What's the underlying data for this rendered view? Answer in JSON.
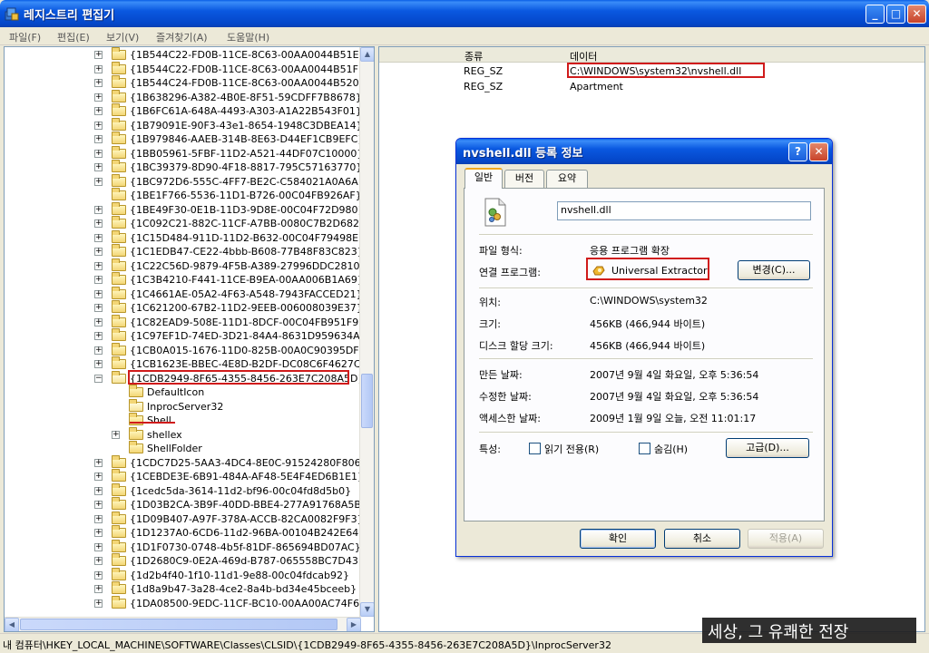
{
  "window": {
    "title": "레지스트리 편집기",
    "min_glyph": "_",
    "max_glyph": "□",
    "close_glyph": "✕"
  },
  "menu": [
    "파일(F)",
    "편집(E)",
    "보기(V)",
    "즐겨찾기(A)",
    "도움말(H)"
  ],
  "tree": {
    "items": [
      {
        "label": "{1B544C22-FD0B-11CE-8C63-00AA0044B51E}",
        "level": 0,
        "expander": "+"
      },
      {
        "label": "{1B544C22-FD0B-11CE-8C63-00AA0044B51F}",
        "level": 0,
        "expander": "+"
      },
      {
        "label": "{1B544C24-FD0B-11CE-8C63-00AA0044B520}",
        "level": 0,
        "expander": "+"
      },
      {
        "label": "{1B638296-A382-4B0E-8F51-59CDFF7B8678}",
        "level": 0,
        "expander": "+"
      },
      {
        "label": "{1B6FC61A-648A-4493-A303-A1A22B543F01}",
        "level": 0,
        "expander": "+"
      },
      {
        "label": "{1B79091E-90F3-43e1-8654-1948C3DBEA14}",
        "level": 0,
        "expander": "+"
      },
      {
        "label": "{1B979846-AAEB-314B-8E63-D44EF1CB9EFC}",
        "level": 0,
        "expander": "+"
      },
      {
        "label": "{1BB05961-5FBF-11D2-A521-44DF07C10000}",
        "level": 0,
        "expander": "+"
      },
      {
        "label": "{1BC39379-8D90-4F18-8817-795C57163770}",
        "level": 0,
        "expander": "+"
      },
      {
        "label": "{1BC972D6-555C-4FF7-BE2C-C584021A0A6A}",
        "level": 0,
        "expander": "+"
      },
      {
        "label": "{1BE1F766-5536-11D1-B726-00C04FB926AF}",
        "level": 0,
        "expander": ""
      },
      {
        "label": "{1BE49F30-0E1B-11D3-9D8E-00C04F72D980}",
        "level": 0,
        "expander": "+"
      },
      {
        "label": "{1C092C21-882C-11CF-A7BB-0080C7B2D682}",
        "level": 0,
        "expander": "+"
      },
      {
        "label": "{1C15D484-911D-11D2-B632-00C04F79498E}",
        "level": 0,
        "expander": "+"
      },
      {
        "label": "{1C1EDB47-CE22-4bbb-B608-77B48F83C823}",
        "level": 0,
        "expander": "+"
      },
      {
        "label": "{1C22C56D-9879-4F5B-A389-27996DDC2810}",
        "level": 0,
        "expander": "+"
      },
      {
        "label": "{1C3B4210-F441-11CE-B9EA-00AA006B1A69}",
        "level": 0,
        "expander": "+"
      },
      {
        "label": "{1C4661AE-05A2-4F63-A548-7943FACCED21}",
        "level": 0,
        "expander": "+"
      },
      {
        "label": "{1C621200-67B2-11D2-9EEB-006008039E37}",
        "level": 0,
        "expander": "+"
      },
      {
        "label": "{1C82EAD9-508E-11D1-8DCF-00C04FB951F9}",
        "level": 0,
        "expander": "+"
      },
      {
        "label": "{1C97EF1D-74ED-3D21-84A4-8631D959634A}",
        "level": 0,
        "expander": "+"
      },
      {
        "label": "{1CB0A015-1676-11D0-825B-00A0C90395DF}",
        "level": 0,
        "expander": "+"
      },
      {
        "label": "{1CB1623E-BBEC-4E8D-B2DF-DC08C6F4627C}",
        "level": 0,
        "expander": "+"
      },
      {
        "label": "{1CDB2949-8F65-4355-8456-263E7C208A5D}",
        "level": 0,
        "expander": "−",
        "open": true
      },
      {
        "label": "DefaultIcon",
        "level": 1,
        "expander": ""
      },
      {
        "label": "InprocServer32",
        "level": 1,
        "expander": "",
        "open": true
      },
      {
        "label": "Shell",
        "level": 1,
        "expander": ""
      },
      {
        "label": "shellex",
        "level": 1,
        "expander": "+"
      },
      {
        "label": "ShellFolder",
        "level": 1,
        "expander": ""
      },
      {
        "label": "{1CDC7D25-5AA3-4DC4-8E0C-91524280F806}",
        "level": 0,
        "expander": "+"
      },
      {
        "label": "{1CEBDE3E-6B91-484A-AF48-5E4F4ED6B1E1}",
        "level": 0,
        "expander": "+"
      },
      {
        "label": "{1cedc5da-3614-11d2-bf96-00c04fd8d5b0}",
        "level": 0,
        "expander": "+"
      },
      {
        "label": "{1D03B2CA-3B9F-40DD-BBE4-277A91768A5B}",
        "level": 0,
        "expander": "+"
      },
      {
        "label": "{1D09B407-A97F-378A-ACCB-82CA0082F9F3}",
        "level": 0,
        "expander": "+"
      },
      {
        "label": "{1D1237A0-6CD6-11d2-96BA-00104B242E64}",
        "level": 0,
        "expander": "+"
      },
      {
        "label": "{1D1F0730-0748-4b5f-81DF-865694BD07AC}",
        "level": 0,
        "expander": "+"
      },
      {
        "label": "{1D2680C9-0E2A-469d-B787-065558BC7D43}",
        "level": 0,
        "expander": "+"
      },
      {
        "label": "{1d2b4f40-1f10-11d1-9e88-00c04fdcab92}",
        "level": 0,
        "expander": "+"
      },
      {
        "label": "{1d8a9b47-3a28-4ce2-8a4b-bd34e45bceeb}",
        "level": 0,
        "expander": "+"
      },
      {
        "label": "{1DA08500-9EDC-11CF-BC10-00AA00AC74F6}",
        "level": 0,
        "expander": "+"
      }
    ]
  },
  "values": {
    "headers": [
      "종류",
      "데이터"
    ],
    "rows": [
      {
        "type": "REG_SZ",
        "data": "C:\\WINDOWS\\system32\\nvshell.dll"
      },
      {
        "type": "REG_SZ",
        "data": "Apartment"
      }
    ]
  },
  "status": {
    "path": "내 컴퓨터\\HKEY_LOCAL_MACHINE\\SOFTWARE\\Classes\\CLSID\\{1CDB2949-8F65-4355-8456-263E7C208A5D}\\InprocServer32"
  },
  "watermark": "세상, 그 유쾌한 전장",
  "dialog": {
    "title": "nvshell.dll 등록 정보",
    "help_glyph": "?",
    "close_glyph": "✕",
    "tabs": [
      "일반",
      "버전",
      "요약"
    ],
    "filename": "nvshell.dll",
    "fields": [
      {
        "label": "파일 형식:",
        "value": "응용 프로그램 확장"
      },
      {
        "label": "연결 프로그램:",
        "value": "Universal Extractor"
      },
      {
        "label": "위치:",
        "value": "C:\\WINDOWS\\system32"
      },
      {
        "label": "크기:",
        "value": "456KB (466,944 바이트)"
      },
      {
        "label": "디스크 할당 크기:",
        "value": "456KB (466,944 바이트)"
      },
      {
        "label": "만든 날짜:",
        "value": "2007년 9월 4일 화요일, 오후 5:36:54"
      },
      {
        "label": "수정한 날짜:",
        "value": "2007년 9월 4일 화요일, 오후 5:36:54"
      },
      {
        "label": "액세스한 날짜:",
        "value": "2009년 1월 9일 오늘, 오전 11:01:17"
      }
    ],
    "change_button": "변경(C)...",
    "attributes_label": "특성:",
    "readonly_label": "읽기 전용(R)",
    "hidden_label": "숨김(H)",
    "advanced_button": "고급(D)...",
    "ok_button": "확인",
    "cancel_button": "취소",
    "apply_button": "적용(A)"
  },
  "colors": {
    "highlight_red": "#d01b1b",
    "titlebar_blue": "#0a58e0",
    "folder_yellow": "#f3d676"
  }
}
